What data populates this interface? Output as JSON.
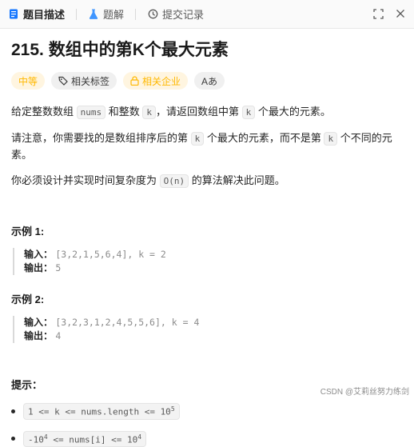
{
  "tabs": [
    {
      "label": "题目描述",
      "icon": "doc-icon",
      "active": true
    },
    {
      "label": "题解",
      "icon": "flask-icon",
      "active": false
    },
    {
      "label": "提交记录",
      "icon": "history-icon",
      "active": false
    }
  ],
  "problem": {
    "title": "215. 数组中的第K个最大元素",
    "difficulty": "中等",
    "tag_related": "相关标签",
    "tag_company": "相关企业",
    "tag_font": "Aあ"
  },
  "description": {
    "p1_a": "给定整数数组 ",
    "p1_code1": "nums",
    "p1_b": " 和整数 ",
    "p1_code2": "k",
    "p1_c": "，请返回数组中第 ",
    "p1_code3": "k",
    "p1_d": " 个最大的元素。",
    "p2_a": "请注意，你需要找的是数组排序后的第 ",
    "p2_code1": "k",
    "p2_b": " 个最大的元素，而不是第 ",
    "p2_code2": "k",
    "p2_c": " 个不同的元素。",
    "p3_a": "你必须设计并实现时间复杂度为 ",
    "p3_code": "O(n)",
    "p3_b": " 的算法解决此问题。"
  },
  "examples": [
    {
      "title": "示例 1:",
      "input_label": "输入：",
      "input_value": "[3,2,1,5,6,4], k = 2",
      "output_label": "输出：",
      "output_value": "5"
    },
    {
      "title": "示例 2:",
      "input_label": "输入：",
      "input_value": "[3,2,3,1,2,4,5,5,6], k = 4",
      "output_label": "输出：",
      "output_value": "4"
    }
  ],
  "hints": {
    "title": "提示：",
    "item1_a": "1 <= k <= nums.length <= 10",
    "item1_exp": "5",
    "item2_a": "-10",
    "item2_exp1": "4",
    "item2_b": " <= nums[i] <= 10",
    "item2_exp2": "4"
  },
  "watermark": "CSDN @艾莉丝努力练剑",
  "colors": {
    "accent_difficulty": "#ffb800",
    "text": "#262626"
  }
}
